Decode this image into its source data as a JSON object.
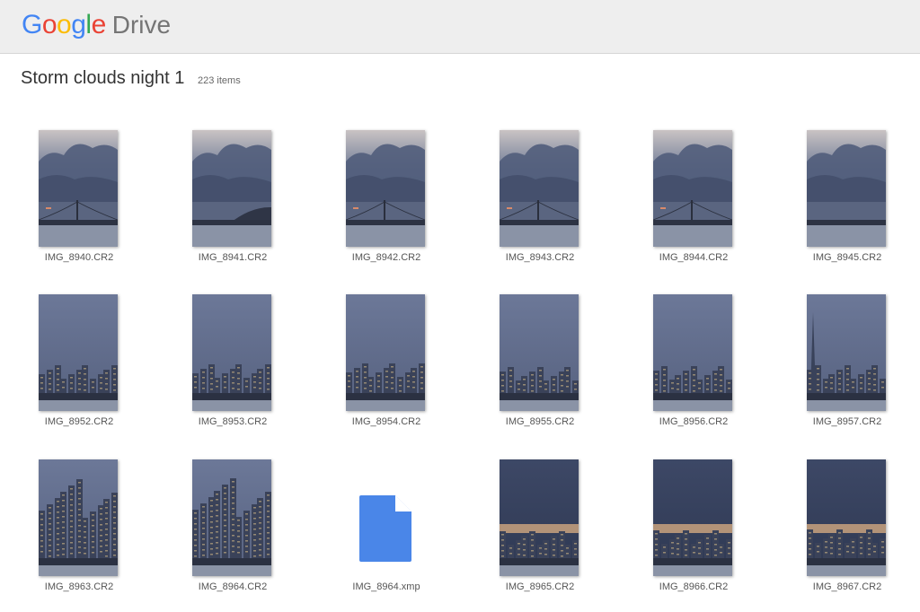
{
  "header": {
    "logo_letters": [
      {
        "ch": "G",
        "color": "#4285F4"
      },
      {
        "ch": "o",
        "color": "#EA4335"
      },
      {
        "ch": "o",
        "color": "#FBBC05"
      },
      {
        "ch": "g",
        "color": "#4285F4"
      },
      {
        "ch": "l",
        "color": "#34A853"
      },
      {
        "ch": "e",
        "color": "#EA4335"
      }
    ],
    "product": "Drive"
  },
  "folder": {
    "title": "Storm clouds night 1",
    "count": "223 items"
  },
  "files": [
    {
      "name": "IMG_8940.CR2",
      "scene": "bridge"
    },
    {
      "name": "IMG_8941.CR2",
      "scene": "bay-hill"
    },
    {
      "name": "IMG_8942.CR2",
      "scene": "bridge"
    },
    {
      "name": "IMG_8943.CR2",
      "scene": "bridge"
    },
    {
      "name": "IMG_8944.CR2",
      "scene": "bridge"
    },
    {
      "name": "IMG_8945.CR2",
      "scene": "bay"
    },
    {
      "name": "IMG_8952.CR2",
      "scene": "city-low"
    },
    {
      "name": "IMG_8953.CR2",
      "scene": "city-low"
    },
    {
      "name": "IMG_8954.CR2",
      "scene": "city-low"
    },
    {
      "name": "IMG_8955.CR2",
      "scene": "city-low"
    },
    {
      "name": "IMG_8956.CR2",
      "scene": "city-low"
    },
    {
      "name": "IMG_8957.CR2",
      "scene": "city-pyramid"
    },
    {
      "name": "IMG_8963.CR2",
      "scene": "city-tall"
    },
    {
      "name": "IMG_8964.CR2",
      "scene": "city-tall"
    },
    {
      "name": "IMG_8964.xmp",
      "scene": "document-icon"
    },
    {
      "name": "IMG_8965.CR2",
      "scene": "city-dusk"
    },
    {
      "name": "IMG_8966.CR2",
      "scene": "city-dusk"
    },
    {
      "name": "IMG_8967.CR2",
      "scene": "city-dusk"
    }
  ],
  "colors": {
    "doc_icon": "#4A86E8",
    "sky": "#5f6d8c",
    "water": "#8a93a6"
  }
}
